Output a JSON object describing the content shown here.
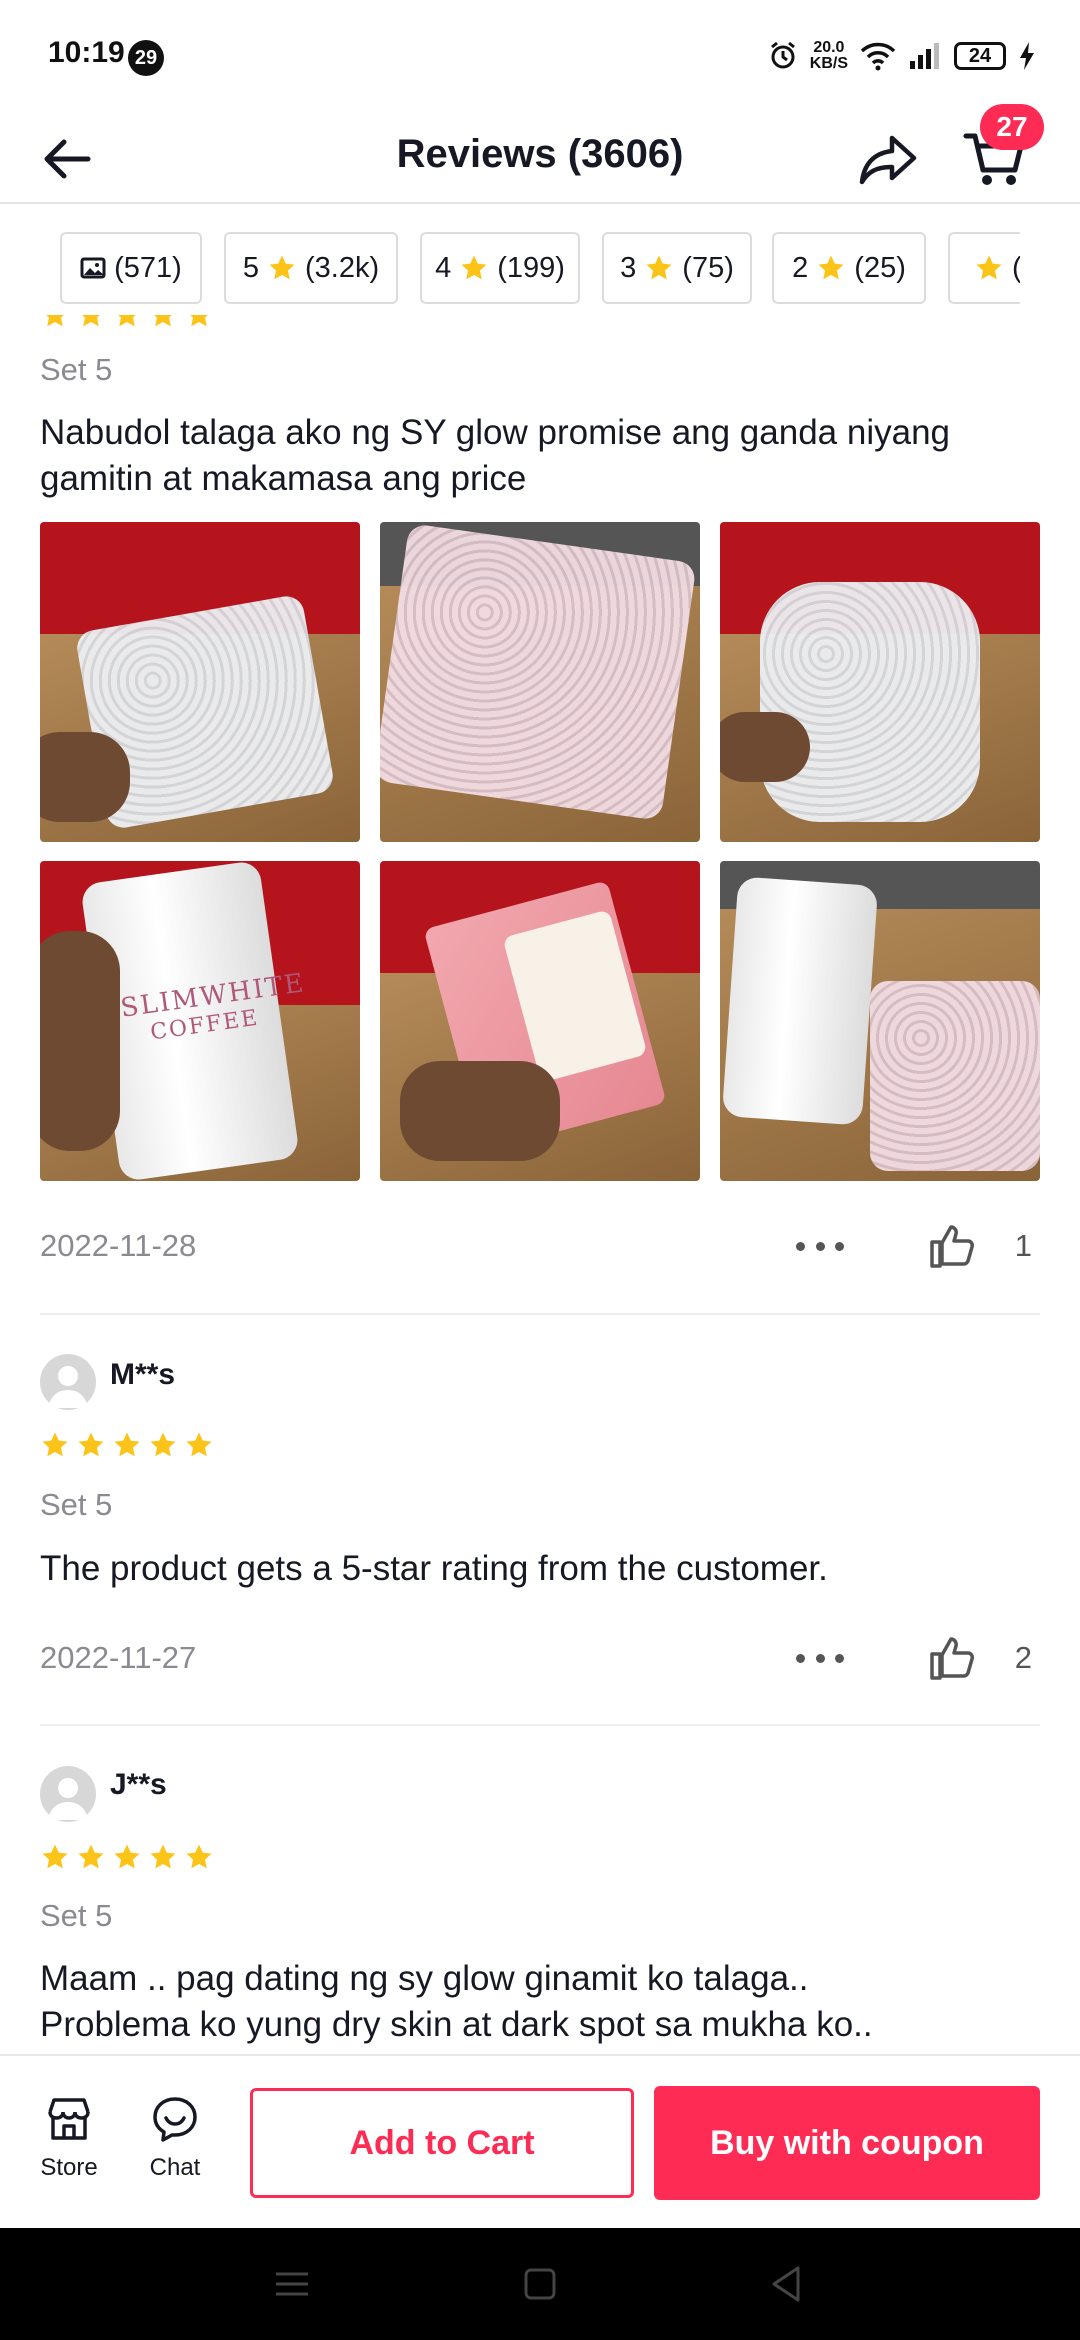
{
  "status_bar": {
    "time": "10:19",
    "notification_count": "29",
    "net_speed_value": "20.0",
    "net_speed_unit": "KB/S",
    "battery": "24"
  },
  "header": {
    "title": "Reviews (3606)",
    "cart_badge": "27"
  },
  "filters": [
    {
      "prefix": "",
      "label": "(571)",
      "icon": "image-icon"
    },
    {
      "prefix": "5",
      "label": "(3.2k)",
      "icon": "star-icon"
    },
    {
      "prefix": "4",
      "label": "(199)",
      "icon": "star-icon"
    },
    {
      "prefix": "3",
      "label": "(75)",
      "icon": "star-icon"
    },
    {
      "prefix": "2",
      "label": "(25)",
      "icon": "star-icon"
    },
    {
      "prefix": "",
      "label": "(",
      "icon": "star-icon"
    }
  ],
  "reviews": [
    {
      "rating": 5,
      "variant": "Set 5",
      "text_line1": "Nabudol talaga ako ng SY glow promise ang ganda niyang",
      "text_line2": "gamitin at makamasa ang price",
      "date": "2022-11-28",
      "likes": "1"
    },
    {
      "user": "M**s",
      "rating": 5,
      "variant": "Set 5",
      "text": "The product gets a 5-star rating from the customer.",
      "date": "2022-11-27",
      "likes": "2"
    },
    {
      "user": "J**s",
      "rating": 5,
      "variant": "Set 5",
      "text_line1": "Maam .. pag dating ng sy glow ginamit ko talaga..",
      "text_line2": "Problema ko yung dry skin at dark spot sa mukha  ko.."
    }
  ],
  "photo_labels": {
    "coffee_brand": "SLIMWHITE",
    "coffee_sub": "COFFEE"
  },
  "bottom_bar": {
    "store_label": "Store",
    "chat_label": "Chat",
    "add_to_cart": "Add to Cart",
    "buy_with_coupon": "Buy with coupon"
  },
  "colors": {
    "accent": "#fe2c55",
    "star": "#fcc419",
    "muted_text": "#8a8b91"
  }
}
